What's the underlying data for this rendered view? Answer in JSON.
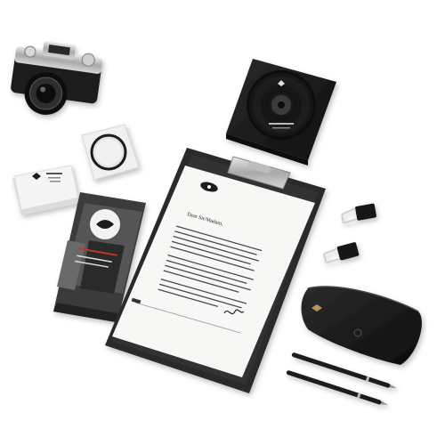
{
  "scene": {
    "background": "#ffffff",
    "palette": {
      "ink": "#151515",
      "clipboard": "#2a2a2a",
      "paper": "#f7f7f5",
      "metal": "#c9c9c9",
      "gold": "#b8955a"
    },
    "objects": [
      "camera",
      "lens-filter",
      "cd-case",
      "business-cards",
      "brochure",
      "clipboard-letterhead",
      "binder-clips",
      "glasses-case",
      "pens"
    ],
    "letter": {
      "greeting": "Dear Sir/Madam,"
    }
  }
}
